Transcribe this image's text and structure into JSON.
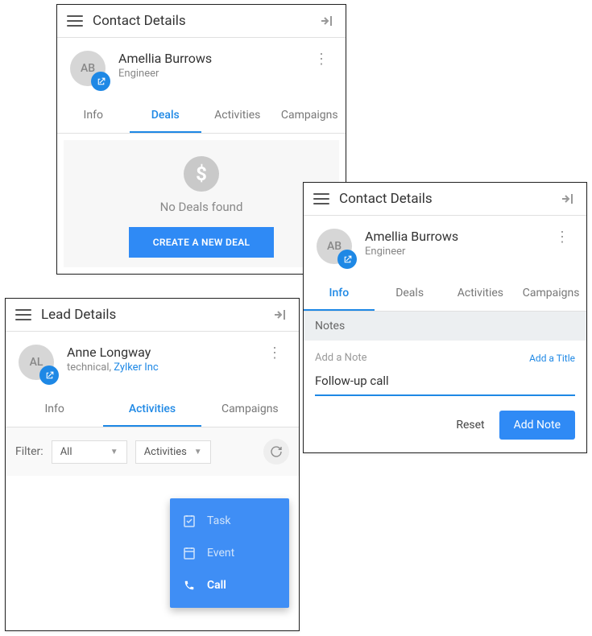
{
  "panel1": {
    "title": "Contact Details",
    "avatar_initials": "AB",
    "name": "Amellia Burrows",
    "role": "Engineer",
    "tabs": {
      "info": "Info",
      "deals": "Deals",
      "activities": "Activities",
      "campaigns": "Campaigns"
    },
    "no_deals_text": "No Deals found",
    "create_deal_label": "CREATE A NEW DEAL"
  },
  "panel2": {
    "title": "Lead Details",
    "avatar_initials": "AL",
    "name": "Anne Longway",
    "role_prefix": "technical, ",
    "company": "Zylker Inc",
    "tabs": {
      "info": "Info",
      "activities": "Activities",
      "campaigns": "Campaigns"
    },
    "filter_label": "Filter:",
    "filter_value": "All",
    "filter_type": "Activities",
    "menu": {
      "task": "Task",
      "event": "Event",
      "call": "Call"
    }
  },
  "panel3": {
    "title": "Contact Details",
    "avatar_initials": "AB",
    "name": "Amellia Burrows",
    "role": "Engineer",
    "tabs": {
      "info": "Info",
      "deals": "Deals",
      "activities": "Activities",
      "campaigns": "Campaigns"
    },
    "notes_header": "Notes",
    "add_note_label": "Add a Note",
    "add_title_link": "Add a Title",
    "note_value": "Follow-up call",
    "reset_label": "Reset",
    "add_note_button": "Add Note"
  }
}
